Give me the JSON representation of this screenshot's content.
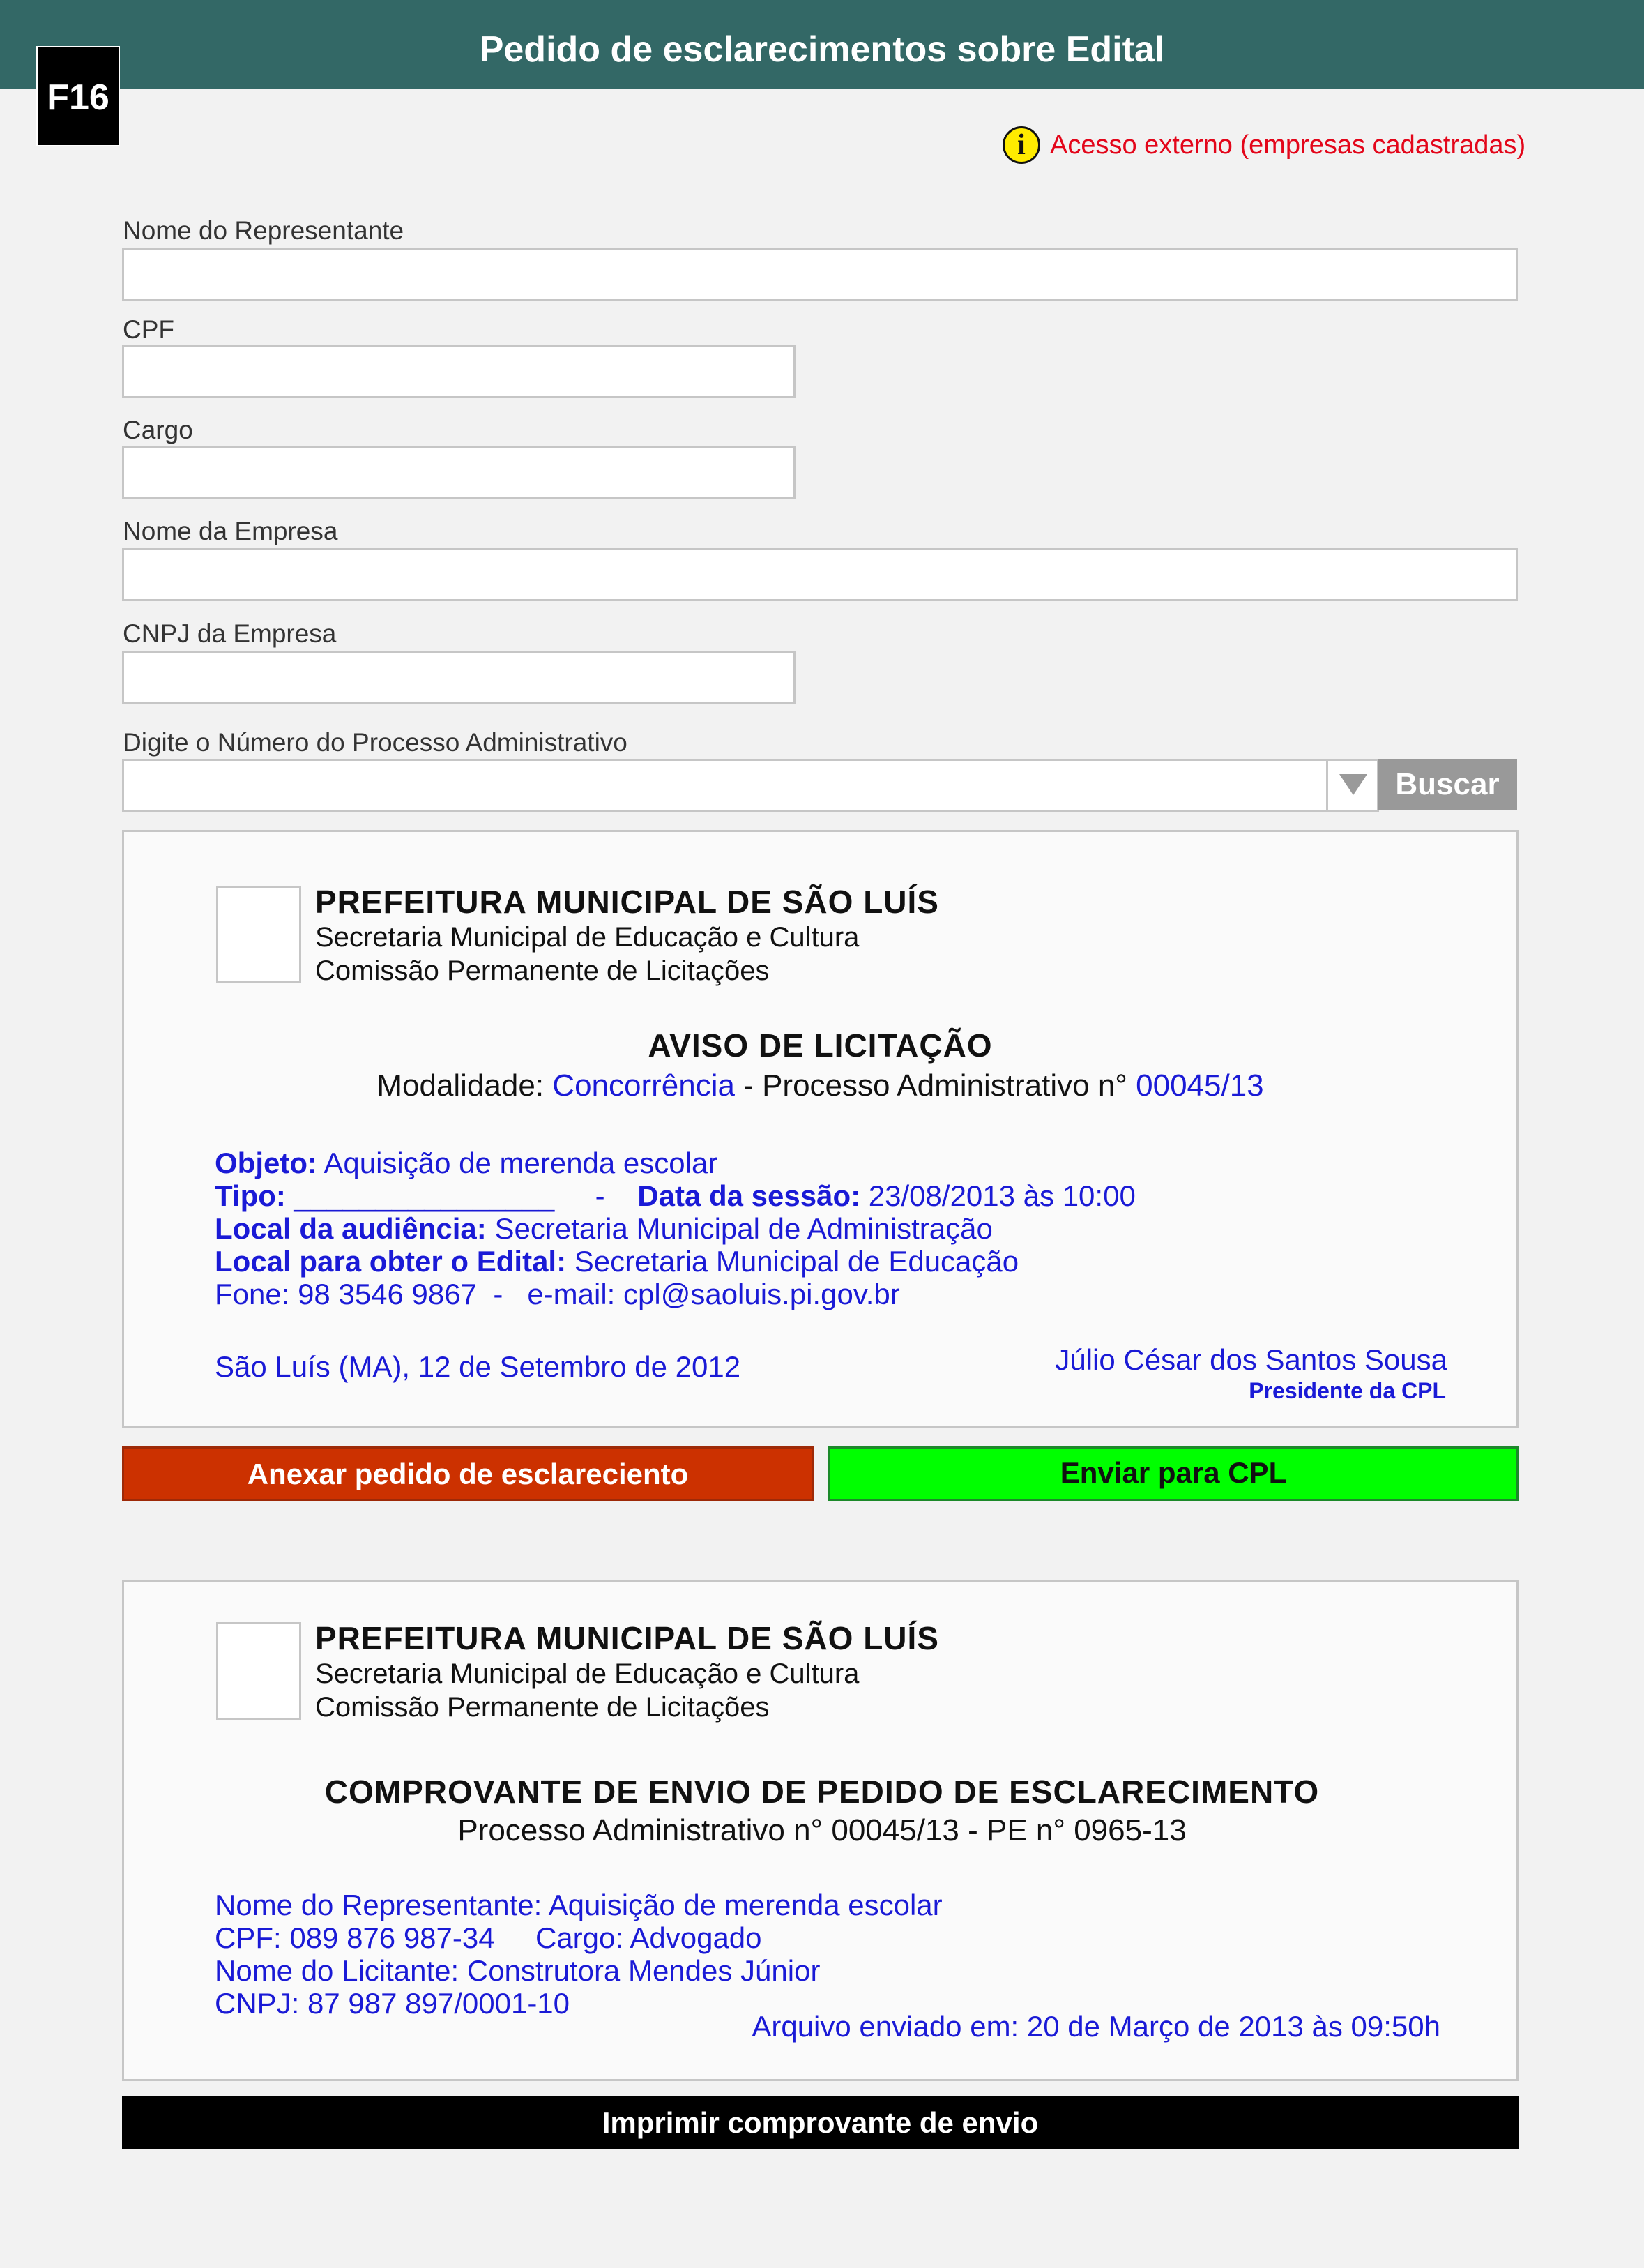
{
  "header": {
    "title": "Pedido de esclarecimentos sobre Edital",
    "badge": "F16"
  },
  "access_notice": {
    "icon": "info-icon",
    "text": "Acesso externo (empresas cadastradas)"
  },
  "form": {
    "nome_representante_label": "Nome do Representante",
    "nome_representante_value": "",
    "cpf_label": "CPF",
    "cpf_value": "",
    "cargo_label": "Cargo",
    "cargo_value": "",
    "nome_empresa_label": "Nome da Empresa",
    "nome_empresa_value": "",
    "cnpj_label": "CNPJ da Empresa",
    "cnpj_value": "",
    "processo_label": "Digite o Número do Processo Administrativo",
    "processo_value": "",
    "search_button": "Buscar"
  },
  "aviso": {
    "org": "PREFEITURA MUNICIPAL DE SÃO LUÍS",
    "dept1": "Secretaria Municipal de Educação e Cultura",
    "dept2": "Comissão Permanente de Licitações",
    "title": "AVISO DE LICITAÇÃO",
    "modalidade_label": "Modalidade: ",
    "modalidade_value": "Concorrência",
    "processo_label": " - Processo Administrativo n° ",
    "processo_value": "00045/13",
    "objeto_label": "Objeto:",
    "objeto_value": " Aquisição de merenda escolar",
    "tipo_label": "Tipo:",
    "tipo_value": " ________________     -    ",
    "data_label": "Data da sessão:",
    "data_value": " 23/08/2013 às 10:00",
    "local_aud_label": "Local da audiência:",
    "local_aud_value": " Secretaria Municipal de Administração",
    "local_edital_label": "Local para obter o Edital:",
    "local_edital_value": " Secretaria Municipal de Educação",
    "contato": "Fone: 98 3546 9867  -   e-mail: cpl@saoluis.pi.gov.br",
    "local_data": "São Luís (MA), 12 de Setembro de 2012",
    "signatario": "Júlio César dos Santos Sousa",
    "cargo_signatario": "Presidente da CPL"
  },
  "actions": {
    "attach_button": "Anexar pedido de esclareciento",
    "send_button": "Enviar para CPL"
  },
  "comprovante": {
    "org": "PREFEITURA MUNICIPAL DE SÃO LUÍS",
    "dept1": "Secretaria Municipal de Educação e Cultura",
    "dept2": "Comissão Permanente de Licitações",
    "title": "COMPROVANTE DE ENVIO DE PEDIDO DE ESCLARECIMENTO",
    "subtitle": "Processo Administrativo n° 00045/13 - PE n° 0965-13",
    "representante": "Nome do Representante: Aquisição de merenda escolar",
    "cpf_cargo": "CPF: 089 876 987-34     Cargo: Advogado",
    "licitante": "Nome do Licitante: Construtora Mendes Júnior",
    "cnpj": "CNPJ: 87 987 897/0001-10",
    "enviado": "Arquivo enviado em: 20 de Março de 2013 às 09:50h"
  },
  "print_button": "Imprimir comprovante de envio"
}
